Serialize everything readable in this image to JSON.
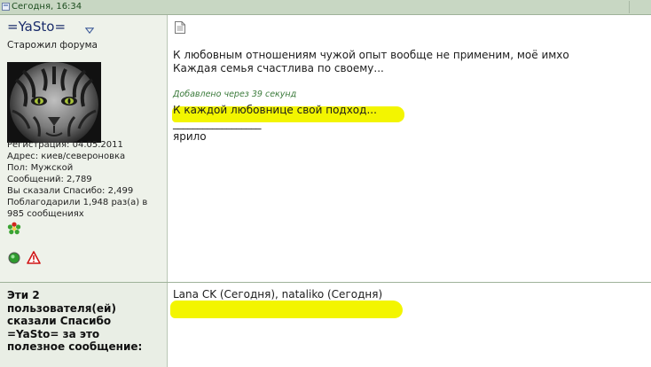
{
  "header": {
    "date": "Сегодня, 16:34"
  },
  "user": {
    "name": "=YaSto=",
    "title": "Старожил форума",
    "info": [
      "Регистрация: 04.05.2011",
      "Адрес: киев/североновка",
      "Пол: Мужской",
      "Сообщений: 2,789",
      "Вы сказали Спасибо: 2,499",
      "Поблагодарили 1,948 раз(а) в",
      "985 сообщениях"
    ]
  },
  "post": {
    "lines": [
      "К любовным отношениям чужой опыт вообще не применим, моё имхо",
      "Каждая семья счастлива по своему..."
    ],
    "added_note": "Добавлено через 39 секунд",
    "added_text": "К каждой любовнице свой подход...",
    "signature_line": "__________________",
    "signature": "ярило"
  },
  "thanks": {
    "label_lines": [
      "Эти 2",
      "пользователя(ей)",
      "сказали Спасибо",
      "=YaSto= за это",
      "полезное сообщение:"
    ],
    "users": "Lana CK (Сегодня), nataliko (Сегодня)"
  },
  "colors": {
    "highlight": "#f3f500",
    "header": "#c8d7c3",
    "username": "#1a2c6b"
  }
}
